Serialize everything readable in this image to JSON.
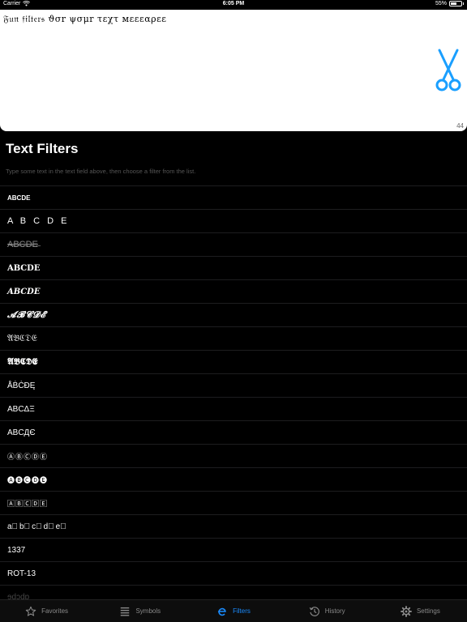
{
  "status_bar": {
    "carrier": "Carrier",
    "time": "6:05 PM",
    "battery": "55%",
    "battery_level": 0.55
  },
  "input": {
    "text": "𝔉𝔲𝔫 𝔣𝔦𝔩𝔱𝔢𝔯𝔰 ϑσr ψσμr τεχτ мεεεαρεε",
    "char_count": "44",
    "accent_color": "#1a9fff"
  },
  "section": {
    "title": "Text Filters",
    "hint": "Type some text in the text field above, then choose a filter from the list."
  },
  "filters": [
    "ABCDE",
    "A B C D E",
    "A̶B̶C̶D̶E̶",
    "𝐀𝐁𝐂𝐃𝐄",
    "𝑨𝑩𝑪𝑫𝑬",
    "𝓐𝓑𝓒𝓓𝓔",
    "𝔄𝔅ℭ𝔇𝔈",
    "𝕬𝕭𝕮𝕯𝕰",
    "ÅḂĊĐĘ",
    "ABCΔΞ",
    "ABCДЄ",
    "ⒶⒷⒸⒹⒺ",
    "🅐🅑🅒🅓🅔",
    "🄰🄱🄲🄳🄴",
    "a⃞b⃞c⃞d⃞e⃞",
    "1337",
    "ROT-13",
    "ɘdɔdɒ"
  ],
  "tabs": [
    {
      "label": "Favorites",
      "icon": "star-icon"
    },
    {
      "label": "Symbols",
      "icon": "list-icon"
    },
    {
      "label": "Filters",
      "icon": "filter-icon",
      "active": true
    },
    {
      "label": "History",
      "icon": "history-icon"
    },
    {
      "label": "Settings",
      "icon": "gear-icon"
    }
  ]
}
